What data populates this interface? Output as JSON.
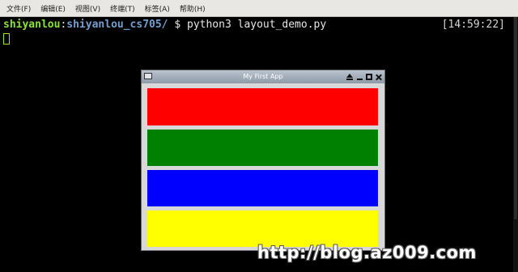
{
  "menubar": {
    "items": [
      "文件(F)",
      "编辑(E)",
      "视图(V)",
      "终端(T)",
      "标签(A)",
      "帮助(H)"
    ]
  },
  "terminal": {
    "prompt_user": "shiyanlou",
    "prompt_colon": ":",
    "prompt_path": "shiyanlou_cs705/",
    "prompt_symbol": " $ ",
    "command": "python3 layout_demo.py",
    "clock": "[14:59:22]"
  },
  "app_window": {
    "title": "My First App",
    "panels": [
      {
        "name": "red",
        "color": "#ff0000"
      },
      {
        "name": "green",
        "color": "#008000"
      },
      {
        "name": "blue",
        "color": "#0000ff"
      },
      {
        "name": "yellow",
        "color": "#ffff00"
      }
    ]
  },
  "watermark": "http://blog.az009.com"
}
